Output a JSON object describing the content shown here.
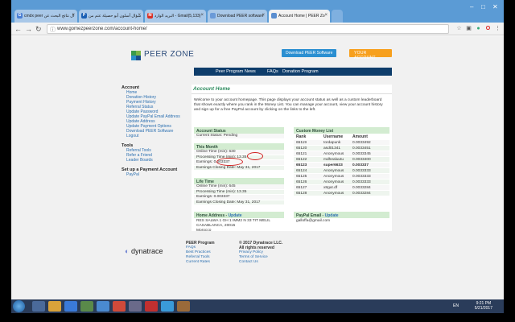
{
  "browser": {
    "tabs": [
      {
        "label": "cmdx peer ال نتائج البحث عن",
        "icon_color": "#4a7fd4",
        "active": false
      },
      {
        "label": "سؤال أسلون أبو حصيلة عتم من",
        "icon_color": "#1a5fb4",
        "active": false
      },
      {
        "label": "البريد الوارد - Gmail(5,133)",
        "icon_color": "#d93025",
        "active": false
      },
      {
        "label": "Download PEER software",
        "icon_color": "#6a9ad8",
        "active": false
      },
      {
        "label": "Account Home | PEER Zo",
        "icon_color": "#5a8ed0",
        "active": true
      }
    ],
    "url": "www.gomezpeerzone.com/account-home/"
  },
  "site": {
    "brand": "PEER ZONE",
    "download_button": "Download PEER Software",
    "account_button": "YOUR ACCOUNT",
    "nav": [
      "Peer Program",
      "News",
      "FAQs",
      "Donation Program"
    ],
    "leftnav": {
      "account_head": "Account",
      "account_links": [
        "Home",
        "Donation History",
        "Payment History",
        "Referral Status",
        "Update Password",
        "Update PayPal Email Address",
        "Update Address",
        "Update Payment Options",
        "Download PEER Software",
        "Logout"
      ],
      "tools_head": "Tools",
      "tools_links": [
        "Referral Tools",
        "Refer a Friend",
        "Leader Boards"
      ],
      "payment_head": "Set up a Payment Account",
      "payment_links": [
        "PayPal"
      ]
    },
    "content": {
      "title": "Account Home",
      "intro": "Welcome to your account homepage. This page displays your account status as well as a custom leaderboard that shows exactly where you rank in the Money List. You can manage your account, view your account history and sign up for a free PayPal account by clicking on the links to the left.",
      "account_status": {
        "head": "Account Status",
        "status": "Current Status: Pending"
      },
      "this_month": {
        "head": "This Month",
        "rows": [
          "Online Time (min): 630",
          "Processing Time (min): 13.35",
          "Earnings: 0.003337",
          "Earnings Closing Date: May 31, 2017"
        ]
      },
      "life_time": {
        "head": "Life Time",
        "rows": [
          "Online Time (min): 645",
          "Processing Time (min): 13.35",
          "Earnings: 0.003337",
          "Earnings Closing Date: May 31, 2017"
        ]
      },
      "money_list": {
        "head": "Custom Money List",
        "columns": [
          "Rank",
          "Username",
          "Amount"
        ],
        "rows": [
          [
            "65119",
            "tordapunk",
            "0.0033492"
          ],
          [
            "65120",
            "asd01341",
            "0.0033451"
          ],
          [
            "65121",
            "Anonymous",
            "0.0033345"
          ],
          [
            "65122",
            "mdhealuutu",
            "0.0033400"
          ],
          [
            "65123",
            "super6633",
            "0.003337"
          ],
          [
            "65124",
            "Anonymous",
            "0.0033333"
          ],
          [
            "65125",
            "Anonymous",
            "0.0033333"
          ],
          [
            "65126",
            "Anonymous",
            "0.0033333"
          ],
          [
            "65127",
            "x8gut.df",
            "0.0033284"
          ],
          [
            "65128",
            "Anonymous",
            "0.0033284"
          ]
        ],
        "highlight_rank": "65123"
      },
      "home_address": {
        "head": "Home Address",
        "update": "Update",
        "lines": [
          "RES SALWA 1 GH 1 IMM2 N 33 TIT MELIL",
          "CASABLANCA, 20015",
          "Morocco"
        ]
      },
      "paypal": {
        "head": "PayPal Email",
        "update": "Update",
        "email": "galloffa@gmail.com"
      }
    },
    "footer": {
      "logo": "dynatrace",
      "col1_head": "PEER Program",
      "col1_links": [
        "FAQs",
        "Best Practices",
        "Referral Tools",
        "Current Rates"
      ],
      "col2_head": "© 2017 Dynatrace LLC.",
      "col2_sub": "All rights reserved",
      "col2_links": [
        "Privacy Policy",
        "Terms of Service",
        "Contact Us"
      ]
    }
  },
  "taskbar": {
    "lang": "EN",
    "time": "9:21 PM",
    "date": "5/21/2017"
  },
  "colors": {
    "tabstrip": "#5b9bd5",
    "navbar": "#0e3d6b",
    "download_btn": "#2b8fd1",
    "account_btn": "#f7a01e",
    "panel_head": "#d3ecd1",
    "accent_green": "#2a8a5c",
    "annotation_red": "#d12020"
  }
}
